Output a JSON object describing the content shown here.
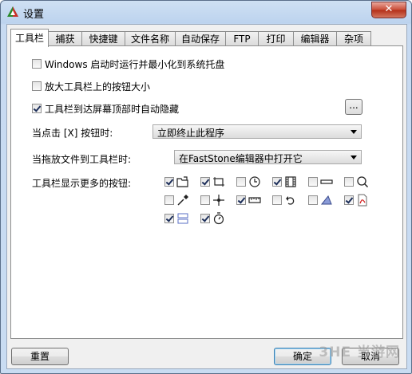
{
  "window": {
    "title": "设置",
    "close_label": "✕"
  },
  "tabs": [
    "工具栏",
    "捕获",
    "快捷键",
    "文件名称",
    "自动保存",
    "FTP",
    "打印",
    "编辑器",
    "杂项"
  ],
  "options": {
    "startup_tray": {
      "label": "Windows 启动时运行并最小化到系统托盘",
      "checked": false
    },
    "enlarge_buttons": {
      "label": "放大工具栏上的按钮大小",
      "checked": false
    },
    "auto_hide": {
      "label": "工具栏到达屏幕顶部时自动隐藏",
      "checked": true
    },
    "auto_hide_settings_label": "..."
  },
  "close_action": {
    "label": "当点击 [X] 按钮时:",
    "value": "立即终止此程序"
  },
  "drop_action": {
    "label": "当拖放文件到工具栏时:",
    "value": "在FastStone编辑器中打开它"
  },
  "extra_buttons": {
    "label": "工具栏显示更多的按钮:",
    "items": [
      {
        "icon": "open-folder-icon",
        "checked": true
      },
      {
        "icon": "crop-icon",
        "checked": true
      },
      {
        "icon": "clock-icon",
        "checked": false
      },
      {
        "icon": "film-icon",
        "checked": true
      },
      {
        "icon": "highlight-bar-icon",
        "checked": false
      },
      {
        "icon": "magnifier-icon",
        "checked": false
      },
      {
        "icon": "color-picker-icon",
        "checked": false
      },
      {
        "icon": "crosshair-icon",
        "checked": false
      },
      {
        "icon": "ruler-icon",
        "checked": true
      },
      {
        "icon": "undo-arrow-icon",
        "checked": false
      },
      {
        "icon": "eraser-icon",
        "checked": false
      },
      {
        "icon": "pdf-icon",
        "checked": true
      },
      {
        "icon": "screen-recorder-icon",
        "checked": true
      },
      {
        "icon": "timer-icon",
        "checked": true
      }
    ]
  },
  "footer": {
    "reset_label": "重置",
    "ok_label": "确定",
    "cancel_label": "取消"
  },
  "watermark": "3HE 当游网"
}
